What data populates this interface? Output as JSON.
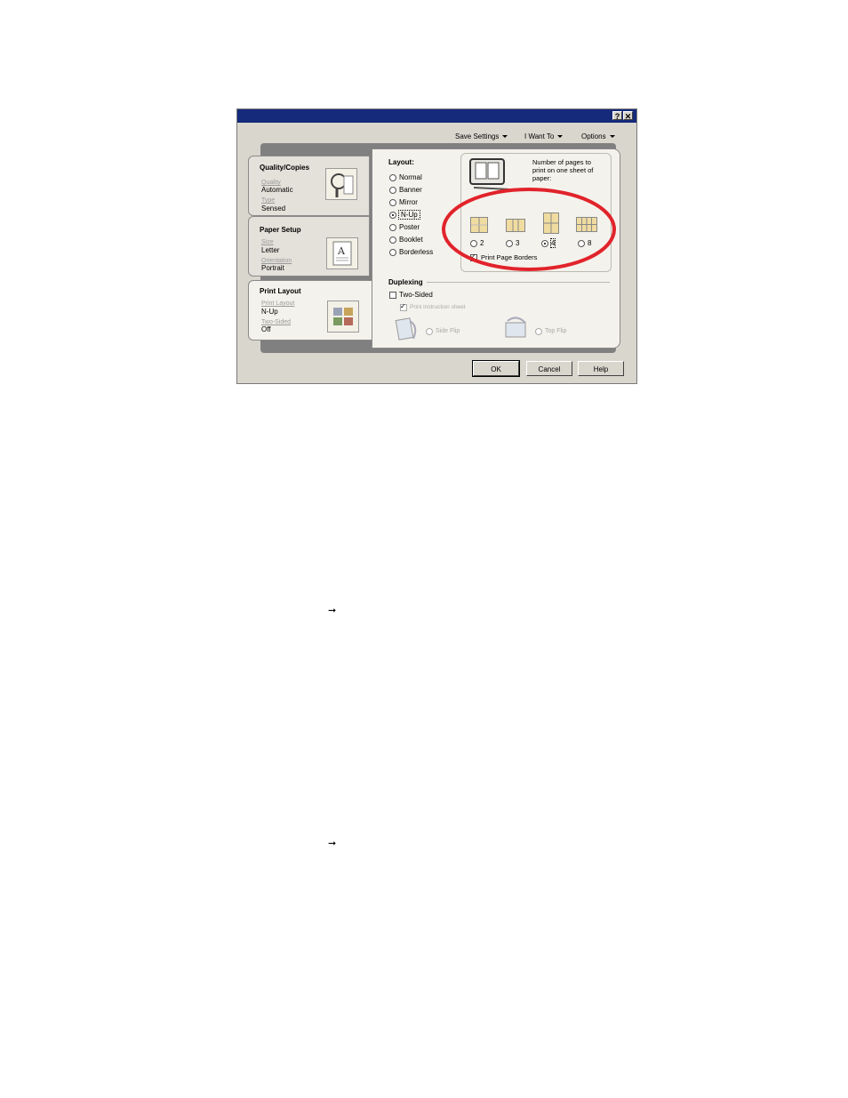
{
  "title_buttons": {
    "help": "?",
    "close": "✕"
  },
  "menu": [
    {
      "label": "Save Settings"
    },
    {
      "label": "I Want To"
    },
    {
      "label": "Options"
    }
  ],
  "tabs": {
    "quality": {
      "title": "Quality/Copies",
      "l1": "Quality",
      "v1": "Automatic",
      "l2": "Type",
      "v2": "Sensed"
    },
    "paper": {
      "title": "Paper Setup",
      "l1": "Size",
      "v1": "Letter",
      "l2": "Orientation",
      "v2": "Portrait"
    },
    "layout": {
      "title": "Print Layout",
      "l1": "Print Layout",
      "v1": "N-Up",
      "l2": "Two-Sided",
      "v2": "Off"
    }
  },
  "layout_section": {
    "heading": "Layout:",
    "options": [
      "Normal",
      "Banner",
      "Mirror",
      "N-Up",
      "Poster",
      "Booklet",
      "Borderless"
    ],
    "selected": "N-Up"
  },
  "nup": {
    "description": [
      "Number of pages to",
      "print on one sheet of",
      "paper:"
    ],
    "options": [
      "2",
      "3",
      "4",
      "8"
    ],
    "selected": "4",
    "borders_label": "Print Page Borders",
    "borders_checked": true
  },
  "duplex": {
    "heading": "Duplexing",
    "two_sided": "Two-Sided",
    "instruction": "Print instruction sheet",
    "side_flip": "Side Flip",
    "top_flip": "Top Flip"
  },
  "buttons": {
    "ok": "OK",
    "cancel": "Cancel",
    "help": "Help"
  },
  "page_arrows": [
    "➞",
    "➞"
  ],
  "highlight_color": "#e1232b",
  "titlebar_color": "#152a7a"
}
